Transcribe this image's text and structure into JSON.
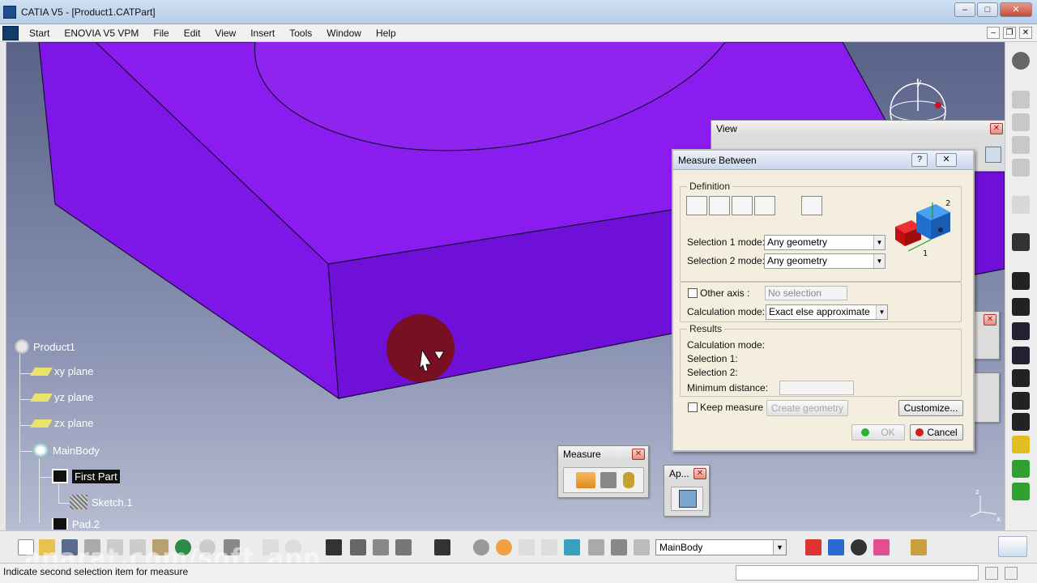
{
  "window": {
    "title": "CATIA V5 - [Product1.CATPart]"
  },
  "menubar": {
    "items": [
      "Start",
      "ENOVIA V5 VPM",
      "File",
      "Edit",
      "View",
      "Insert",
      "Tools",
      "Window",
      "Help"
    ]
  },
  "tree": {
    "root": "Product1",
    "items": [
      {
        "label": "xy plane",
        "icon": "plane-icon"
      },
      {
        "label": "yz plane",
        "icon": "plane-icon"
      },
      {
        "label": "zx plane",
        "icon": "plane-icon"
      },
      {
        "label": "MainBody",
        "icon": "body-gear-icon"
      },
      {
        "label": "First Part",
        "icon": "pad-icon"
      },
      {
        "label": "Sketch.1",
        "icon": "sketch-icon"
      },
      {
        "label": "Pad.2",
        "icon": "pad-icon"
      }
    ]
  },
  "view_panel": {
    "title": "View"
  },
  "measure_dialog": {
    "title": "Measure Between",
    "help_glyph": "?",
    "close_glyph": "✕",
    "definition_label": "Definition",
    "selection1_label": "Selection 1 mode:",
    "selection1_value": "Any geometry",
    "selection2_label": "Selection 2 mode:",
    "selection2_value": "Any geometry",
    "other_axis_label": "Other axis :",
    "other_axis_value": "No selection",
    "calc_mode_label": "Calculation mode:",
    "calc_mode_value": "Exact else approximate",
    "results_label": "Results",
    "result_calc_mode": "Calculation mode:",
    "result_sel1": "Selection 1:",
    "result_sel2": "Selection 2:",
    "min_distance_label": "Minimum distance:",
    "keep_measure_label": "Keep measure",
    "create_geometry_label": "Create geometry",
    "customize_label": "Customize...",
    "ok_label": "OK",
    "cancel_label": "Cancel",
    "cube_label_1": "1",
    "cube_label_2": "2"
  },
  "measure_toolbar": {
    "title": "Measure"
  },
  "ap_toolbar": {
    "title": "Ap..."
  },
  "bottom_toolbar": {
    "body_select_value": "MainBody"
  },
  "status": {
    "message": "Indicate second selection item for measure"
  },
  "watermark": "aparat.com/soft_app",
  "compass": {
    "y_label": "y",
    "z_label": "z",
    "x_label": "x"
  },
  "colors": {
    "part_top": "#8a1cf0",
    "part_side": "#6f10d8",
    "background_top": "#596287",
    "dialog_bg": "#f4eedf"
  }
}
